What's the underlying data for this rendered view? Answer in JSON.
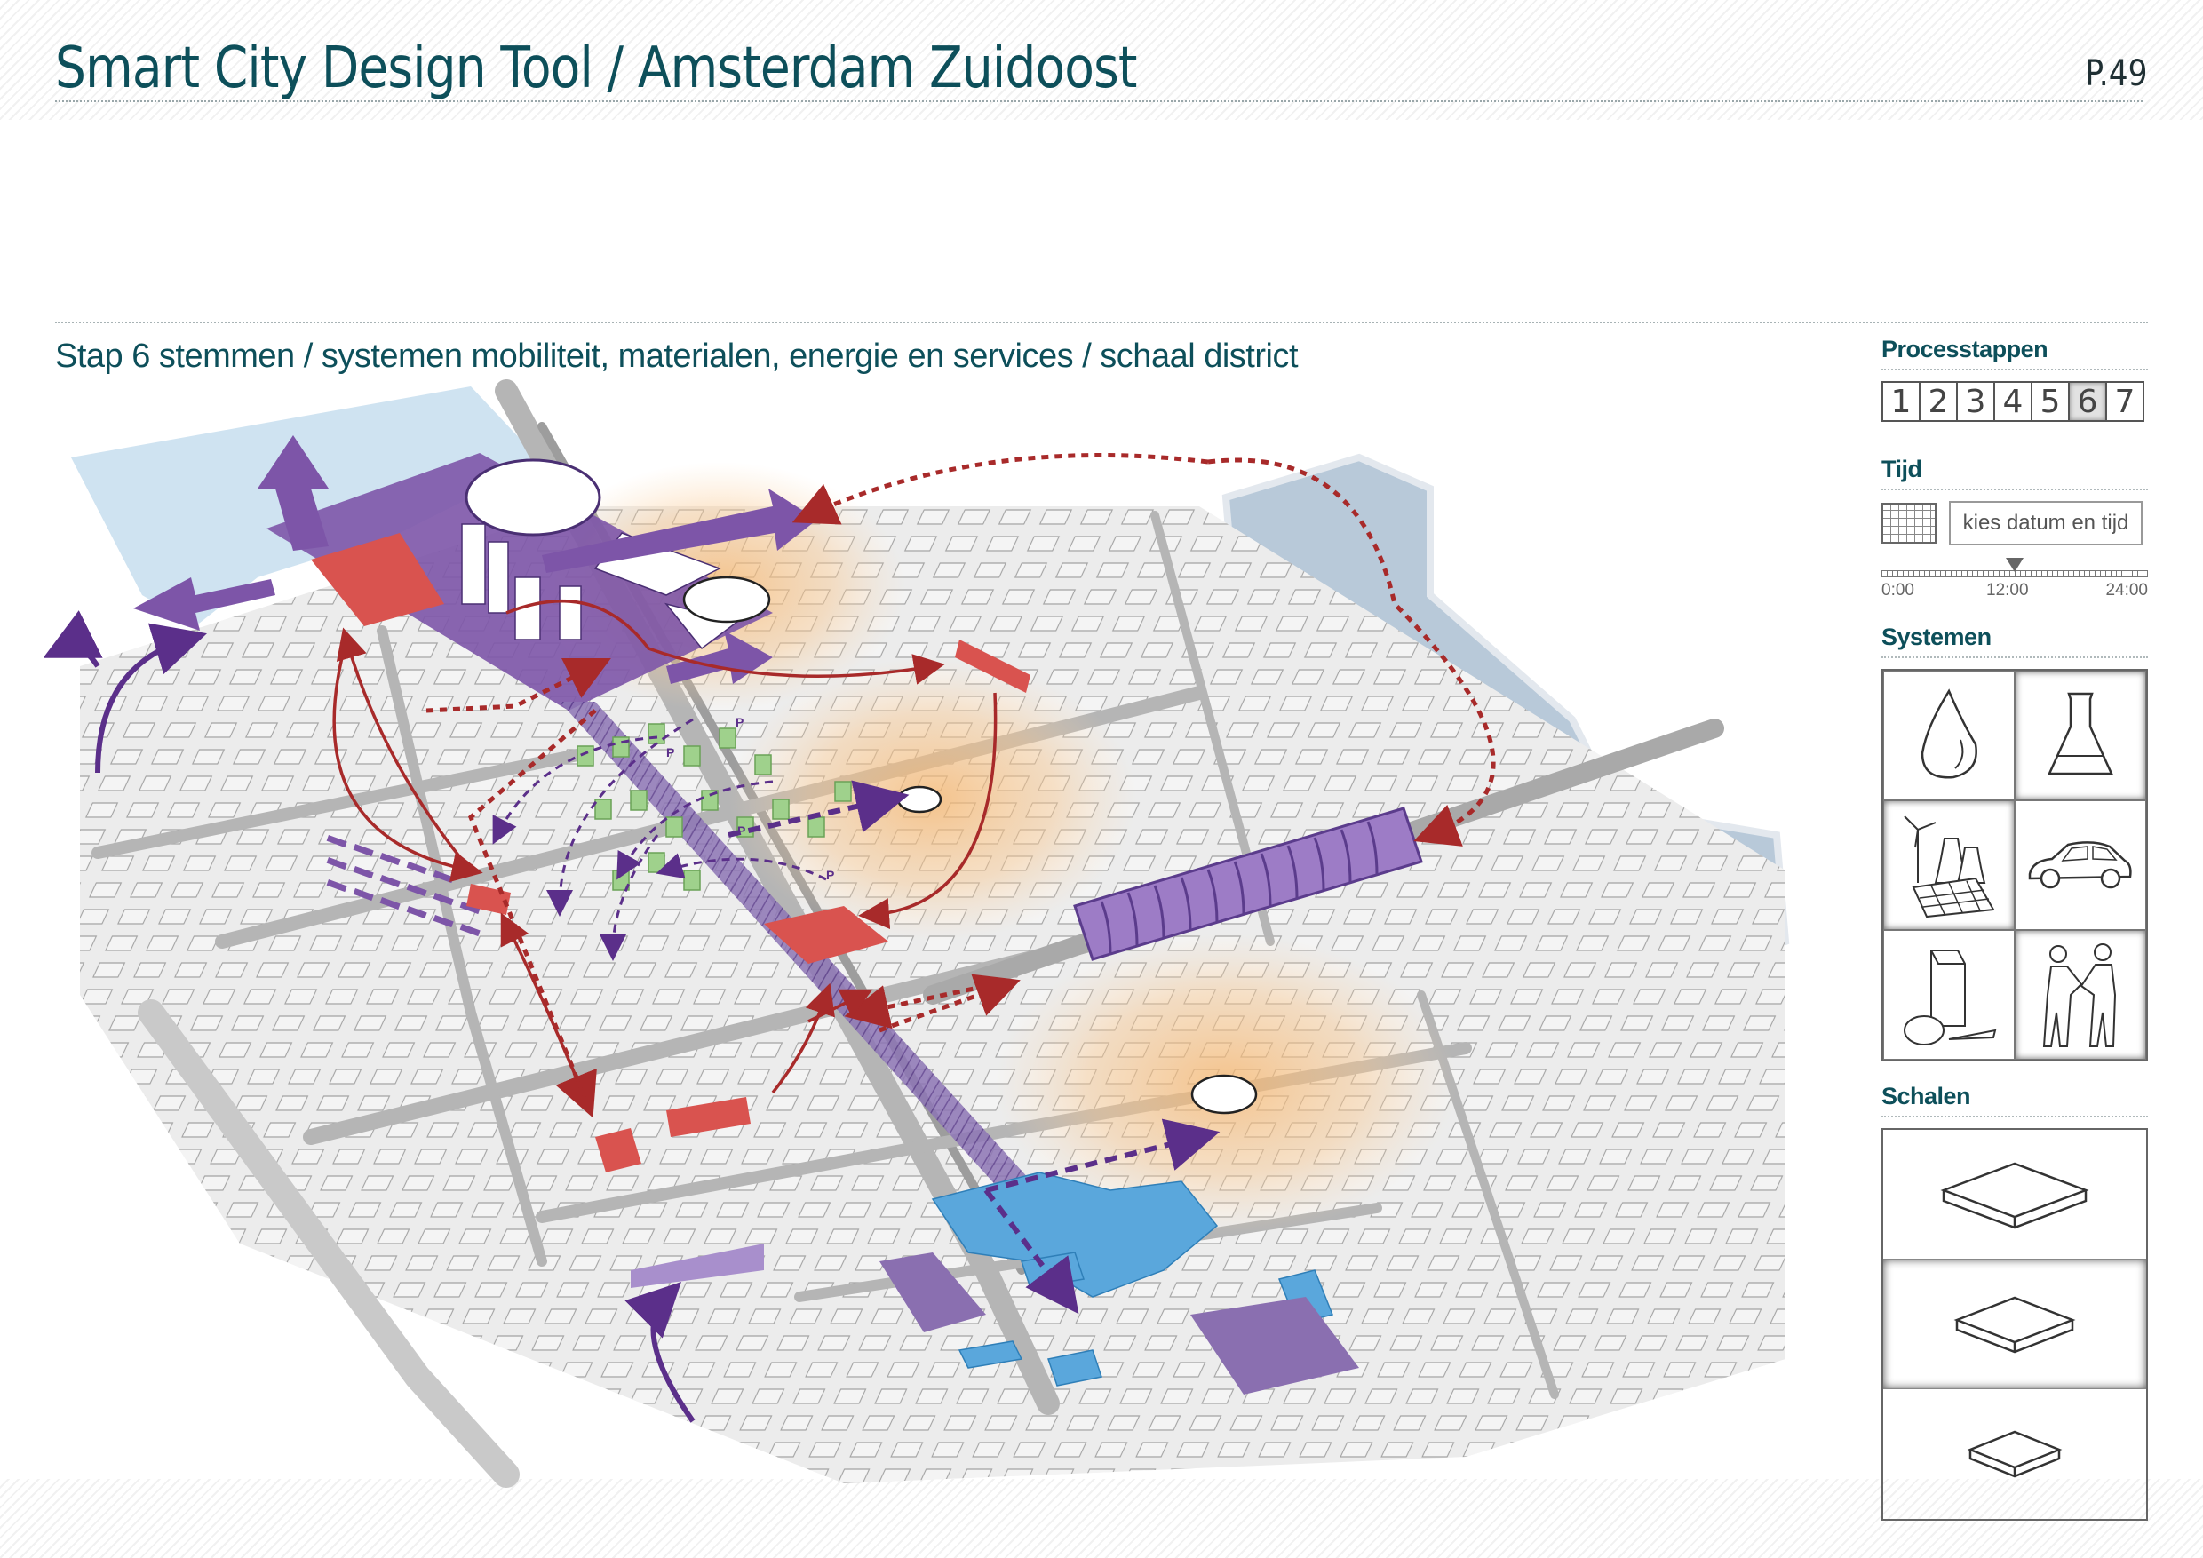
{
  "header": {
    "title": "Smart City Design Tool / Amsterdam Zuidoost",
    "page": "P.49"
  },
  "subtitle": "Stap 6 stemmen / systemen mobiliteit, materialen, energie en services / schaal district",
  "map": {
    "parking_marker": "P",
    "colors": {
      "water": "#b8c9d9",
      "water_light": "#cfe3f1",
      "roads": "#b5b5b5",
      "buildings": "#f4f4f4",
      "purple": "#7d55a8",
      "red": "#d9534f",
      "dark_red_arrow": "#a82a2a",
      "blue": "#5aa7dc",
      "green": "#9fd18c",
      "orange_glow": "#f7b56b"
    }
  },
  "panel": {
    "steps_heading": "Processtappen",
    "steps": [
      "1",
      "2",
      "3",
      "4",
      "5",
      "6",
      "7"
    ],
    "active_step": "6",
    "time_heading": "Tijd",
    "date_button": "kies datum en tijd",
    "time_labels": [
      "0:00",
      "12:00",
      "24:00"
    ],
    "time_value": "12:00",
    "systems_heading": "Systemen",
    "systems": [
      {
        "name": "water-drop-icon"
      },
      {
        "name": "flask-icon"
      },
      {
        "name": "energy-icon"
      },
      {
        "name": "car-icon"
      },
      {
        "name": "food-icon"
      },
      {
        "name": "handshake-icon"
      }
    ],
    "scales_heading": "Schalen",
    "scales": [
      "scale-large-icon",
      "scale-medium-icon",
      "scale-small-icon"
    ],
    "active_scale": "scale-medium-icon"
  }
}
